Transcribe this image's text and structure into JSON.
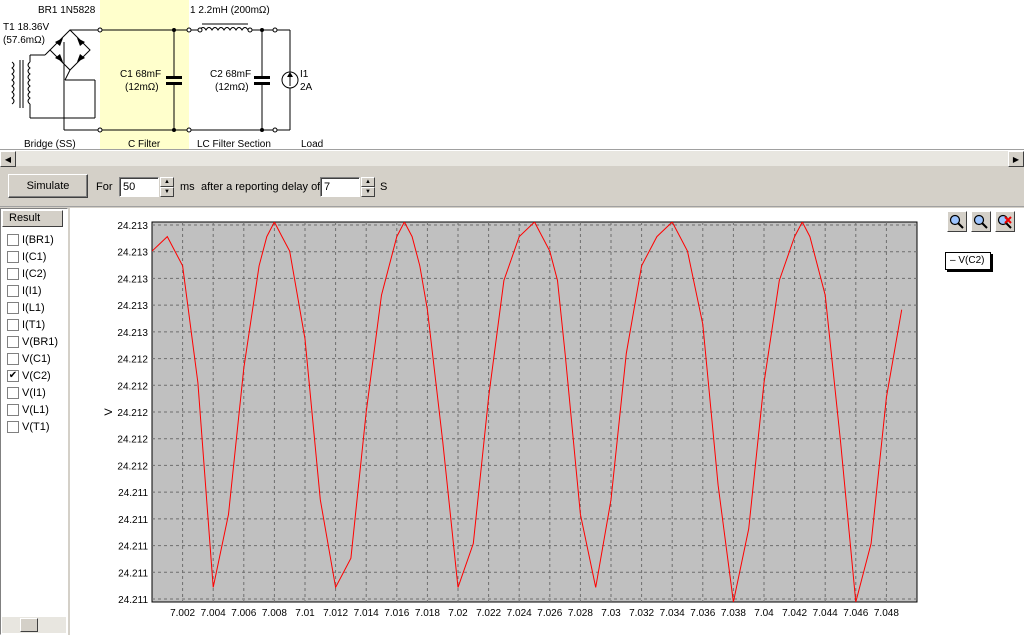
{
  "schematic": {
    "br1_label": "BR1 1N5828",
    "t1_label": "T1 18.36V",
    "t1_res": "(57.6mΩ)",
    "l1_label": "1 2.2mH (200mΩ)",
    "c1_label": "C1 68mF",
    "c1_res": "(12mΩ)",
    "c2_label": "C2 68mF",
    "c2_res": "(12mΩ)",
    "i1_label": "I1",
    "i1_val": "2A",
    "section_bridge": "Bridge (SS)",
    "section_cfilter": "C Filter",
    "section_lcfilter": "LC Filter Section",
    "section_load": "Load",
    "highlight_color": "#ffffcc"
  },
  "toolbar": {
    "simulate_label": "Simulate",
    "for_label": "For",
    "duration_value": "50",
    "ms_label": "ms",
    "delay_label": "after a reporting delay of",
    "delay_value": "7",
    "s_label": "S"
  },
  "results": {
    "header": "Result",
    "items": [
      {
        "label": "I(BR1)",
        "checked": false
      },
      {
        "label": "I(C1)",
        "checked": false
      },
      {
        "label": "I(C2)",
        "checked": false
      },
      {
        "label": "I(I1)",
        "checked": false
      },
      {
        "label": "I(L1)",
        "checked": false
      },
      {
        "label": "I(T1)",
        "checked": false
      },
      {
        "label": "V(BR1)",
        "checked": false
      },
      {
        "label": "V(C1)",
        "checked": false
      },
      {
        "label": "V(C2)",
        "checked": true
      },
      {
        "label": "V(I1)",
        "checked": false
      },
      {
        "label": "V(L1)",
        "checked": false
      },
      {
        "label": "V(T1)",
        "checked": false
      }
    ]
  },
  "legend": {
    "label": "V(C2)"
  },
  "icons": {
    "zoom_in": "zoom-in-icon",
    "zoom_out": "zoom-out-icon",
    "zoom_reset": "zoom-reset-icon"
  },
  "chart_data": {
    "type": "line",
    "ylabel": "V",
    "xlabel": "",
    "x_ticks": [
      "7.002",
      "7.004",
      "7.006",
      "7.008",
      "7.01",
      "7.012",
      "7.014",
      "7.016",
      "7.018",
      "7.02",
      "7.022",
      "7.024",
      "7.026",
      "7.028",
      "7.03",
      "7.032",
      "7.034",
      "7.036",
      "7.038",
      "7.04",
      "7.042",
      "7.044",
      "7.046",
      "7.048"
    ],
    "y_ticks": [
      "24.213",
      "24.213",
      "24.213",
      "24.213",
      "24.213",
      "24.212",
      "24.212",
      "24.212",
      "24.212",
      "24.212",
      "24.211",
      "24.211",
      "24.211",
      "24.211",
      "24.211"
    ],
    "xlim": [
      7.0,
      7.05
    ],
    "ylim": [
      24.2106,
      24.2132
    ],
    "series": [
      {
        "name": "V(C2)",
        "color": "#ff0000",
        "x": [
          7.0,
          7.001,
          7.002,
          7.003,
          7.004,
          7.005,
          7.006,
          7.007,
          7.0075,
          7.008,
          7.0085,
          7.009,
          7.01,
          7.011,
          7.012,
          7.013,
          7.014,
          7.015,
          7.016,
          7.0165,
          7.017,
          7.0175,
          7.018,
          7.019,
          7.02,
          7.021,
          7.022,
          7.023,
          7.024,
          7.025,
          7.0255,
          7.026,
          7.0265,
          7.027,
          7.028,
          7.029,
          7.03,
          7.031,
          7.032,
          7.033,
          7.034,
          7.0345,
          7.035,
          7.036,
          7.037,
          7.038,
          7.039,
          7.04,
          7.041,
          7.042,
          7.0425,
          7.043,
          7.044,
          7.045,
          7.046,
          7.047,
          7.048,
          7.049
        ],
        "y": [
          24.213,
          24.2131,
          24.2129,
          24.2121,
          24.2107,
          24.2112,
          24.2122,
          24.2129,
          24.2131,
          24.2132,
          24.2131,
          24.213,
          24.2124,
          24.2113,
          24.2107,
          24.2109,
          24.2119,
          24.2127,
          24.2131,
          24.2132,
          24.2131,
          24.2129,
          24.2126,
          24.2117,
          24.2107,
          24.211,
          24.212,
          24.2128,
          24.2131,
          24.2132,
          24.2131,
          24.213,
          24.2128,
          24.2123,
          24.2112,
          24.2107,
          24.2113,
          24.2123,
          24.2129,
          24.2131,
          24.2132,
          24.2131,
          24.213,
          24.2125,
          24.2114,
          24.2106,
          24.2111,
          24.2121,
          24.2128,
          24.2131,
          24.2132,
          24.2131,
          24.2127,
          24.2117,
          24.2106,
          24.211,
          24.212,
          24.2126
        ]
      }
    ]
  }
}
